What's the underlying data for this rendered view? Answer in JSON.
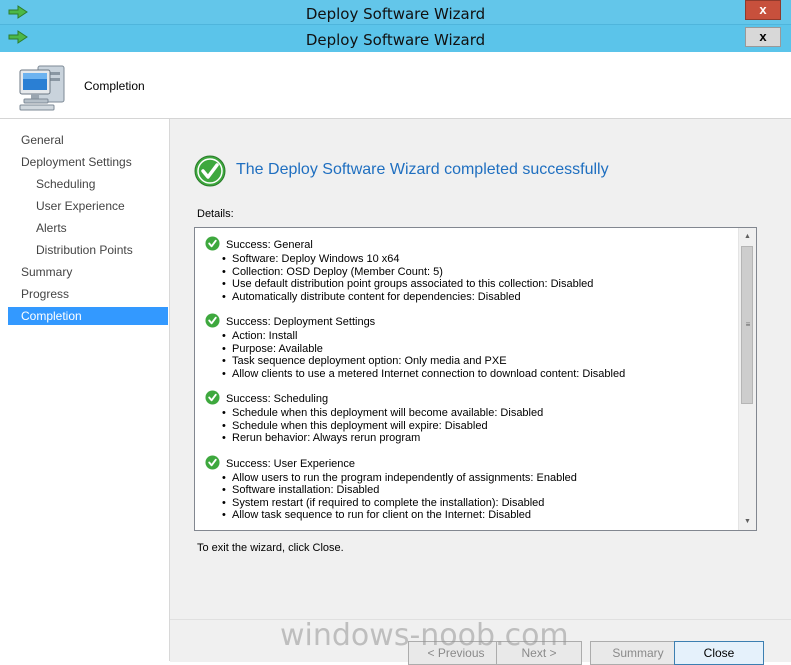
{
  "window": {
    "title_back": "Deploy Software Wizard",
    "title_front": "Deploy Software Wizard",
    "close_glyph": "x",
    "title_icon": "green-arrow-icon"
  },
  "header": {
    "title": "Completion",
    "icon": "computer-icon"
  },
  "sidebar": {
    "items": [
      {
        "label": "General",
        "level": 0
      },
      {
        "label": "Deployment Settings",
        "level": 0
      },
      {
        "label": "Scheduling",
        "level": 1
      },
      {
        "label": "User Experience",
        "level": 1
      },
      {
        "label": "Alerts",
        "level": 1
      },
      {
        "label": "Distribution Points",
        "level": 1
      },
      {
        "label": "Summary",
        "level": 0
      },
      {
        "label": "Progress",
        "level": 0
      },
      {
        "label": "Completion",
        "level": 0,
        "selected": true
      }
    ]
  },
  "main": {
    "success_title": "The Deploy Software Wizard completed successfully",
    "details_label": "Details:",
    "exit_text": "To exit the wizard, click Close.",
    "sections": [
      {
        "title": "Success: General",
        "items": [
          "Software: Deploy Windows 10 x64",
          "Collection: OSD Deploy (Member Count: 5)",
          "Use default distribution point groups associated to this collection: Disabled",
          "Automatically distribute content for dependencies: Disabled"
        ]
      },
      {
        "title": "Success: Deployment Settings",
        "items": [
          "Action: Install",
          "Purpose: Available",
          "Task sequence deployment option: Only media and PXE",
          "Allow clients to use a metered Internet connection to download content: Disabled"
        ]
      },
      {
        "title": "Success: Scheduling",
        "items": [
          "Schedule when this deployment will become available: Disabled",
          "Schedule when this deployment will expire: Disabled",
          "Rerun behavior: Always rerun program"
        ]
      },
      {
        "title": "Success: User Experience",
        "items": [
          "Allow users to run the program independently of assignments: Enabled",
          "Software installation: Disabled",
          "System restart (if required to complete the installation): Disabled",
          "Allow task sequence to run for client on the Internet: Disabled"
        ]
      }
    ]
  },
  "footer": {
    "previous_label": "< Previous",
    "next_label": "Next >",
    "summary_label": "Summary",
    "close_label": "Close"
  },
  "watermark": "windows-noob.com",
  "colors": {
    "titlebar": "#5bc4ea",
    "selection": "#3399ff",
    "success_title": "#1f6fc0",
    "success_green": "#3ea83e"
  }
}
